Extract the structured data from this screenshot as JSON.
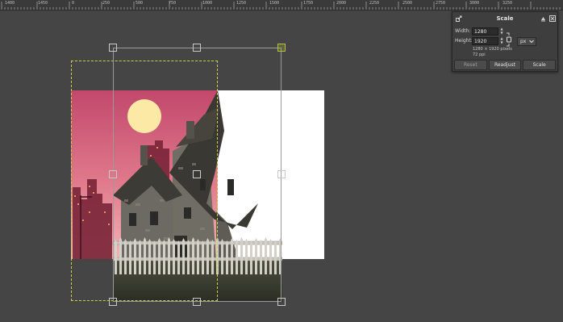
{
  "ruler": {
    "labels": [
      "1400",
      "1450",
      "0",
      "250",
      "500",
      "750",
      "1000",
      "1250",
      "1500",
      "1750",
      "2000",
      "2250",
      "2500",
      "2750",
      "3000",
      "3250"
    ]
  },
  "dialog": {
    "title": "Scale",
    "width_label": "Width:",
    "width_value": "1280",
    "height_label": "Height:",
    "height_value": "1920",
    "unit": "px",
    "pixel_info": "1280 × 1920 pixels",
    "ppi_info": "72 ppi",
    "reset_label": "Reset",
    "readjust_label": "Readjust",
    "scale_label": "Scale",
    "icons": [
      "scale-tool-icon",
      "chain-link-icon",
      "pin-icon",
      "close-icon",
      "chevron-down-icon",
      "spin-up-icon",
      "spin-down-icon"
    ]
  },
  "colors": {
    "canvas_bg": "#454545",
    "selection_border": "#c9cf4a",
    "sky_top": "#c2486c",
    "sky_bottom": "#ef9aa5",
    "moon": "#fbe9a5"
  }
}
